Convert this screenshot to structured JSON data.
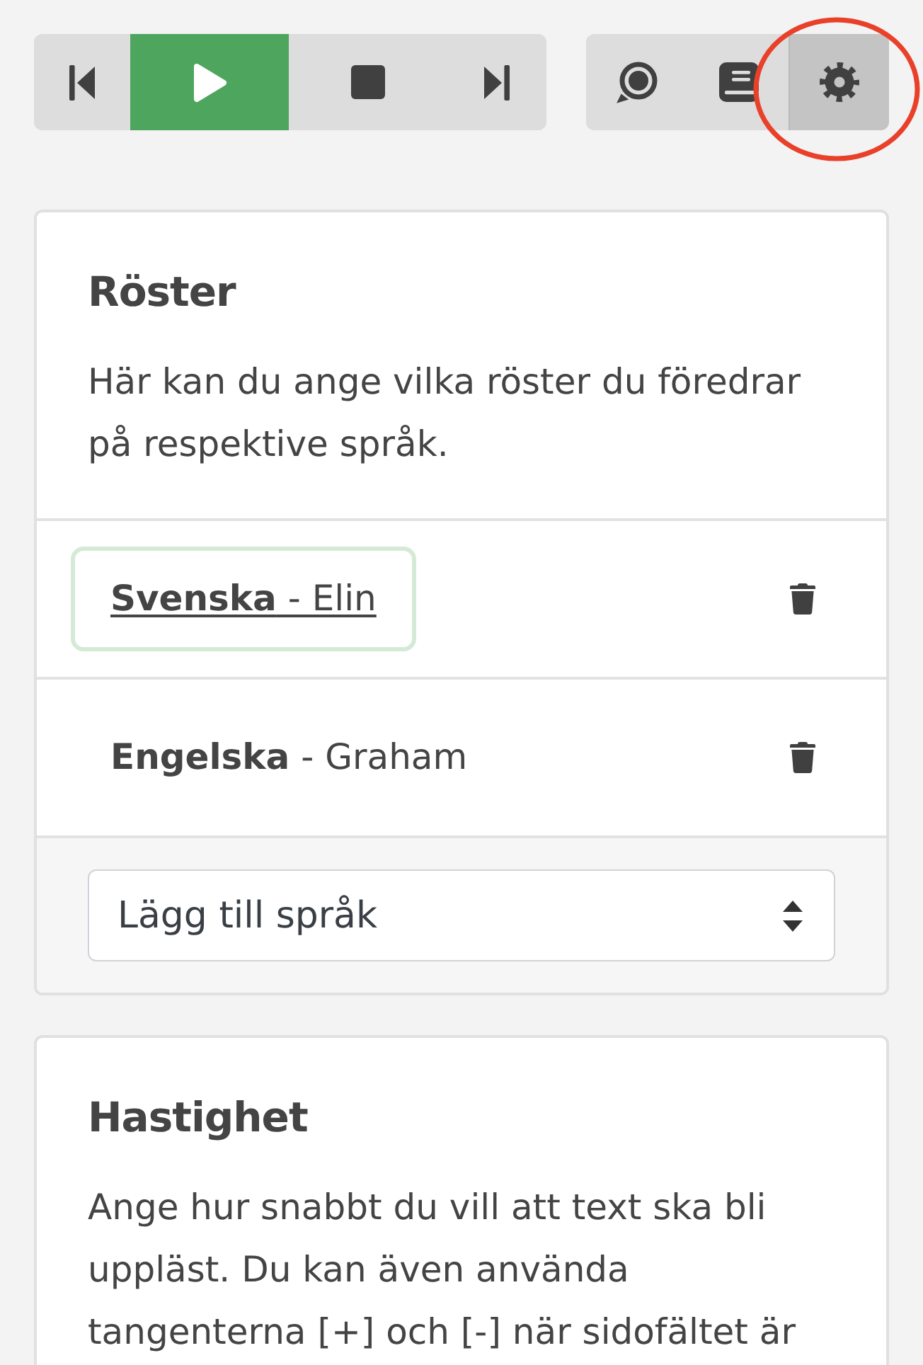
{
  "player_controls": [
    {
      "kind": "previous",
      "primary": false
    },
    {
      "kind": "play",
      "primary": true
    },
    {
      "kind": "stop",
      "primary": false
    },
    {
      "kind": "next",
      "primary": false
    }
  ],
  "panel_tabs": [
    {
      "kind": "speech",
      "selected": false,
      "circled": false
    },
    {
      "kind": "book",
      "selected": false,
      "circled": false
    },
    {
      "kind": "settings",
      "selected": true,
      "circled": true
    }
  ],
  "voices_card": {
    "title": "Röster",
    "description": "Här kan du ange vilka röster du föredrar på respektive språk.",
    "voices": [
      {
        "label": "**Svenska** - Elin",
        "focused": true
      },
      {
        "label": "**Engelska** - Graham",
        "focused": false
      }
    ],
    "add_language_select": {
      "label": "Lägg till språk"
    }
  },
  "speed_card": {
    "title": "Hastighet",
    "description": "Ange hur snabbt du vill att text ska bli uppläst. Du kan även använda tangenterna [+] och [-] när sidofältet är"
  }
}
